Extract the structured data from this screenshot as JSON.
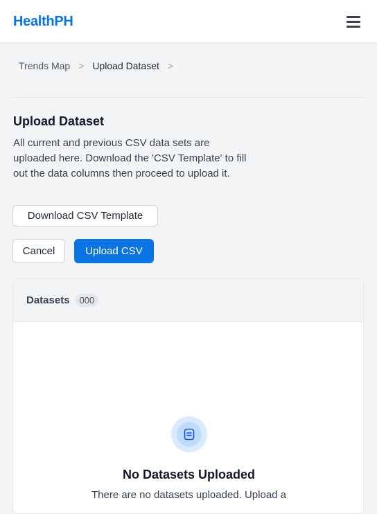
{
  "navbar": {
    "brand": "HealthPH",
    "menu_icon": "hamburger-icon"
  },
  "breadcrumb": {
    "items": [
      "Trends Map",
      "Upload Dataset"
    ],
    "separator": ">"
  },
  "page": {
    "title": "Upload Dataset",
    "description": "All current and previous CSV data sets are uploaded here. Download the 'CSV Template' to fill out the data columns then proceed to upload it."
  },
  "actions": {
    "template_label": "Download CSV Template",
    "cancel_label": "Cancel",
    "upload_label": "Upload CSV"
  },
  "datasets": {
    "title": "Datasets",
    "count": "000",
    "empty_icon": "document-icon",
    "empty_title": "No Datasets Uploaded",
    "empty_desc": "There are no datasets uploaded. Upload a"
  },
  "colors": {
    "brand": "#0b74e5",
    "primary_button": "#0b74e5",
    "empty_icon_bg": "#dbeafe"
  }
}
